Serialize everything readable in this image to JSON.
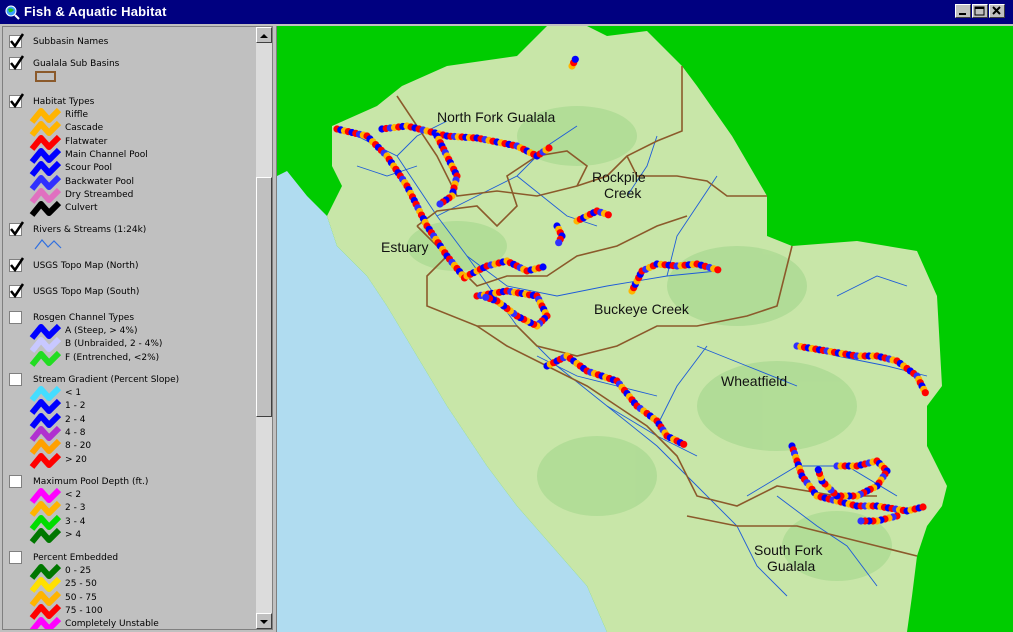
{
  "window": {
    "title": "Fish & Aquatic Habitat"
  },
  "toc": {
    "layers": [
      {
        "name": "Subbasin Names",
        "checked": true
      },
      {
        "name": "Gualala Sub Basins",
        "checked": true
      },
      {
        "name": "Habitat Types",
        "checked": true
      },
      {
        "name": "Rivers & Streams (1:24k)",
        "checked": true
      },
      {
        "name": "USGS Topo Map (North)",
        "checked": true
      },
      {
        "name": "USGS Topo Map (South)",
        "checked": true
      },
      {
        "name": "Rosgen Channel Types",
        "checked": false
      },
      {
        "name": "Stream Gradient (Percent Slope)",
        "checked": false
      },
      {
        "name": "Maximum Pool Depth (ft.)",
        "checked": false
      },
      {
        "name": "Percent Embedded",
        "checked": false
      }
    ],
    "habitat_types": [
      {
        "label": "Riffle",
        "color": "#ffb400"
      },
      {
        "label": "Cascade",
        "color": "#ffb400"
      },
      {
        "label": "Flatwater",
        "color": "#ff0000"
      },
      {
        "label": "Main Channel Pool",
        "color": "#0000ff"
      },
      {
        "label": "Scour Pool",
        "color": "#0000ff"
      },
      {
        "label": "Backwater Pool",
        "color": "#3030ff"
      },
      {
        "label": "Dry Streambed",
        "color": "#e070c0"
      },
      {
        "label": "Culvert",
        "color": "#000000"
      }
    ],
    "rosgen": [
      {
        "label": "A  (Steep, > 4%)",
        "color": "#0000ff"
      },
      {
        "label": "B  (Unbraided, 2 - 4%)",
        "color": "#c8c8ff"
      },
      {
        "label": "F  (Entrenched, <2%)",
        "color": "#22dd22"
      }
    ],
    "gradient": [
      {
        "label": "< 1",
        "color": "#44ddff"
      },
      {
        "label": "1 - 2",
        "color": "#0000ff"
      },
      {
        "label": "2 - 4",
        "color": "#0000ff"
      },
      {
        "label": "4 - 8",
        "color": "#b030d0"
      },
      {
        "label": "8 - 20",
        "color": "#ffa000"
      },
      {
        "label": "> 20",
        "color": "#ff0000"
      }
    ],
    "pool_depth": [
      {
        "label": "< 2",
        "color": "#ff00ff"
      },
      {
        "label": "2 - 3",
        "color": "#ffb400"
      },
      {
        "label": "3 - 4",
        "color": "#00dd00"
      },
      {
        "label": "> 4",
        "color": "#007700"
      }
    ],
    "embedded": [
      {
        "label": "0 - 25",
        "color": "#007700"
      },
      {
        "label": "25 - 50",
        "color": "#ffe000"
      },
      {
        "label": "50 - 75",
        "color": "#ffb400"
      },
      {
        "label": "75 - 100",
        "color": "#ff0000"
      },
      {
        "label": "Completely Unstable",
        "color": "#ff00ff"
      }
    ]
  },
  "map": {
    "labels": [
      "North Fork Gualala",
      "Rockpile",
      "Creek",
      "Estuary",
      "Buckeye Creek",
      "Wheatfield",
      "South Fork",
      "Gualala"
    ],
    "colors": {
      "ocean": "#b0dcf0",
      "outside": "#00cc00",
      "land": "#c8e6a8",
      "boundary": "#8b5a2b",
      "river": "#1e5cd8"
    }
  }
}
